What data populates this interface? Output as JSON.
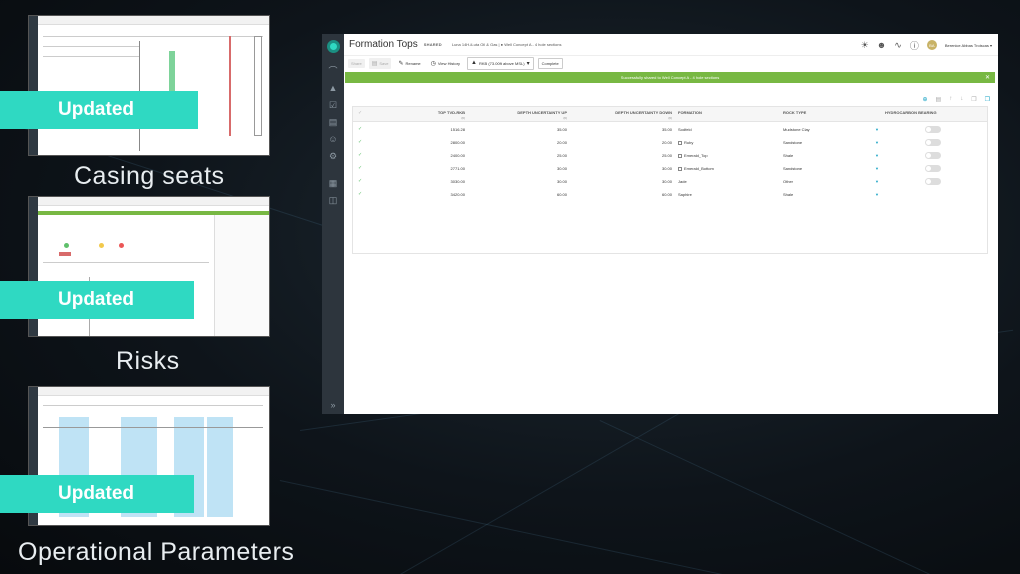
{
  "thumbnails": [
    {
      "badge": "Updated",
      "caption": "Casing seats"
    },
    {
      "badge": "Updated",
      "caption": "Risks"
    },
    {
      "badge": "Updated",
      "caption": "Operational Parameters"
    }
  ],
  "app": {
    "title": "Formation Tops",
    "shared_label": "SHARED",
    "breadcrumb": "Luna 14H-iLuta Oil & Gas | ● Well Concept A - 4 hole sections",
    "user": {
      "initials": "BA",
      "name": "Berenice Abbas Troiscas ▾"
    },
    "toolbar": {
      "share": "Share",
      "save": "Save",
      "rename": "Rename",
      "view_history": "View History",
      "datum": "RKB (73.00ft above MSL)",
      "complete": "Complete"
    },
    "banner": "Successfully shared to Well Concept A - 4 hole sections",
    "table": {
      "columns": [
        {
          "label": "TOP TVD-RKB",
          "unit": "(ft)"
        },
        {
          "label": "DEPTH UNCERTAINTY UP",
          "unit": "(ft)"
        },
        {
          "label": "DEPTH UNCERTAINTY DOWN",
          "unit": "(ft)"
        },
        {
          "label": "FORMATION",
          "unit": ""
        },
        {
          "label": "ROCK TYPE",
          "unit": ""
        },
        {
          "label": "HYDROCARBON BEARING",
          "unit": ""
        }
      ],
      "rows": [
        {
          "top": "1516.28",
          "up": "35.00",
          "down": "35.00",
          "formation": "Sodfeld",
          "rock": "Mudstone Clay",
          "has_form_icon": false
        },
        {
          "top": "2800.00",
          "up": "20.00",
          "down": "20.00",
          "formation": "Ruby",
          "rock": "Sandstone",
          "has_form_icon": true
        },
        {
          "top": "2400.00",
          "up": "25.00",
          "down": "25.00",
          "formation": "Emerald_Top",
          "rock": "Shale",
          "has_form_icon": true
        },
        {
          "top": "2771.00",
          "up": "30.00",
          "down": "30.00",
          "formation": "Emerald_Bottom",
          "rock": "Sandstone",
          "has_form_icon": true
        },
        {
          "top": "3030.00",
          "up": "30.00",
          "down": "30.00",
          "formation": "Jade",
          "rock": "Other",
          "has_form_icon": false
        },
        {
          "top": "3420.00",
          "up": "60.00",
          "down": "60.00",
          "formation": "Saphire",
          "rock": "Shale",
          "has_form_icon": false
        }
      ]
    }
  },
  "colors": {
    "badge": "#2fd9c2",
    "banner": "#78b843",
    "sidebar": "#2d353d",
    "accent": "#19a3c4"
  }
}
